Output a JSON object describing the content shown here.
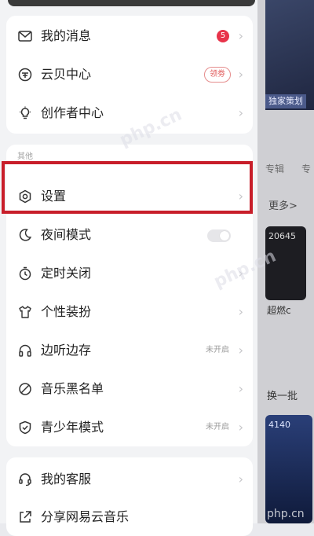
{
  "background": {
    "tag": "独家策划",
    "label1": "专辑",
    "label2": "专",
    "more": "更多>",
    "code1": "20645",
    "label3": "超燃c",
    "refresh": "换一批",
    "code2": "4140",
    "watermark": "php.cn"
  },
  "menu": {
    "card1": [
      {
        "label": "我的消息",
        "badge": "5"
      },
      {
        "label": "云贝中心",
        "pill": "领劵"
      },
      {
        "label": "创作者中心"
      }
    ],
    "section_title": "其他",
    "card2": [
      {
        "label": "设置"
      },
      {
        "label": "夜间模式"
      },
      {
        "label": "定时关闭"
      },
      {
        "label": "个性装扮"
      },
      {
        "label": "边听边存",
        "status": "未开启"
      },
      {
        "label": "音乐黑名单"
      },
      {
        "label": "青少年模式",
        "status": "未开启"
      }
    ],
    "card3": [
      {
        "label": "我的客服"
      },
      {
        "label": "分享网易云音乐"
      }
    ]
  },
  "chevron": "›"
}
